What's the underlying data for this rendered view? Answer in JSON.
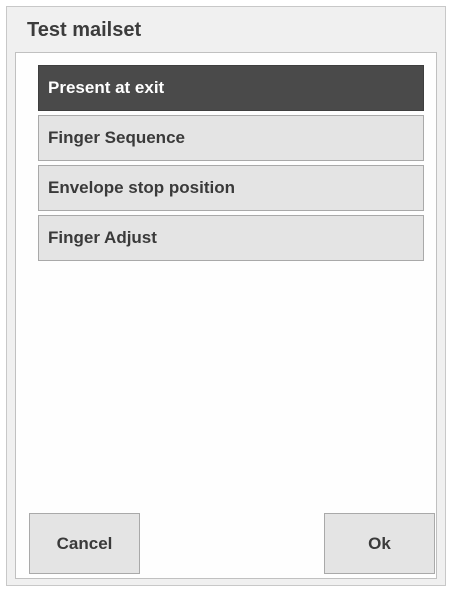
{
  "dialog": {
    "title": "Test mailset"
  },
  "options": [
    {
      "label": "Present at exit",
      "selected": true
    },
    {
      "label": "Finger Sequence",
      "selected": false
    },
    {
      "label": "Envelope stop position",
      "selected": false
    },
    {
      "label": "Finger Adjust",
      "selected": false
    }
  ],
  "buttons": {
    "cancel_label": "Cancel",
    "ok_label": "Ok"
  },
  "colors": {
    "selected_background": "#4a4a4a",
    "item_background": "#e4e4e4",
    "dialog_background": "#f0f0f0"
  }
}
